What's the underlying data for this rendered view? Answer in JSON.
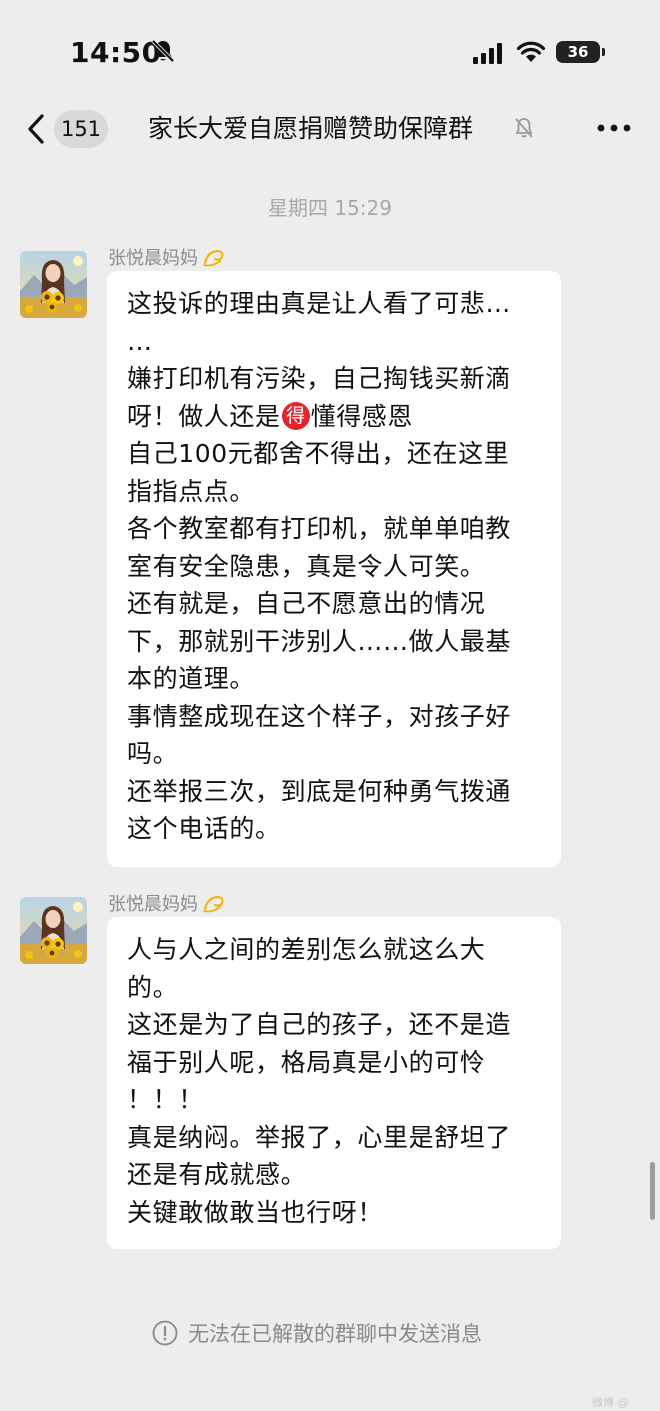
{
  "status_bar": {
    "time": "14:50",
    "battery": "36",
    "icons": [
      "bell-slash-icon",
      "cellular-signal-icon",
      "wifi-icon",
      "battery-icon"
    ]
  },
  "nav": {
    "back_icon": "chevron-left-icon",
    "unread_count": "151",
    "title": "家长大爱自愿捐赠赞助保障群",
    "mute_icon": "bell-slash-icon",
    "more_icon": "ellipsis-icon"
  },
  "chat": {
    "timestamp": "星期四 15:29",
    "messages": [
      {
        "sender": "张悦晨妈妈",
        "lines": [
          "这投诉的理由真是让人看了可悲…",
          "…",
          "嫌打印机有污染，自己掏钱买新滴",
          [
            "呀！做人还是",
            "得",
            "懂得感恩"
          ],
          "自己100元都舍不得出，还在这里",
          "指指点点。",
          "各个教室都有打印机，就单单咱教",
          "室有安全隐患，真是令人可笑。",
          "还有就是，自己不愿意出的情况",
          "下，那就别干涉别人……做人最基",
          "本的道理。",
          "事情整成现在这个样子，对孩子好",
          "吗。",
          "还举报三次，到底是何种勇气拨通",
          "这个电话的。"
        ]
      },
      {
        "sender": "张悦晨妈妈",
        "lines": [
          "人与人之间的差别怎么就这么大",
          "的。",
          "这还是为了自己的孩子，还不是造",
          "福于别人呢，格局真是小的可怜",
          "！！！",
          "真是纳闷。举报了，心里是舒坦了",
          "还是有成就感。",
          "关键敢做敢当也行呀！"
        ]
      }
    ]
  },
  "footer": {
    "notice": "无法在已解散的群聊中发送消息",
    "notice_icon": "exclamation-circle-icon"
  },
  "watermark": "微博 @"
}
